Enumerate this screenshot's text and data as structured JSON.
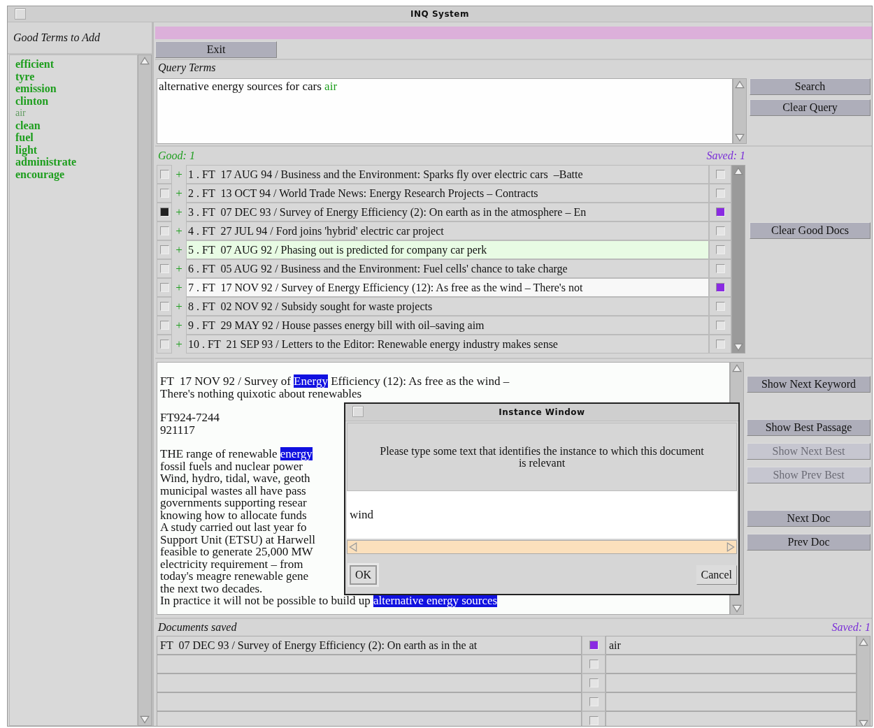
{
  "window": {
    "title": "INQ System"
  },
  "good_terms": {
    "heading": "Good Terms to Add",
    "terms": [
      {
        "text": "efficient",
        "added": false
      },
      {
        "text": "tyre",
        "added": false
      },
      {
        "text": "emission",
        "added": false
      },
      {
        "text": "clinton",
        "added": false
      },
      {
        "text": "air",
        "added": true
      },
      {
        "text": "clean",
        "added": false
      },
      {
        "text": "fuel",
        "added": false
      },
      {
        "text": "light",
        "added": false
      },
      {
        "text": "administrate",
        "added": false
      },
      {
        "text": "encourage",
        "added": false
      }
    ]
  },
  "exit_button": "Exit",
  "query": {
    "label": "Query Terms",
    "terms": [
      {
        "text": "alternative energy sources for cars",
        "kind": "typed"
      },
      {
        "text": "air",
        "kind": "added"
      }
    ],
    "buttons": [
      "Search",
      "Clear Query"
    ]
  },
  "results": {
    "good_count": "Good: 1",
    "saved_count": "Saved: 1",
    "rows": [
      {
        "marker": "+",
        "title": "1 . FT  17 AUG 94 / Business and the Environment: Sparks fly over electric cars  –Batte",
        "good": false,
        "saved": false,
        "highlighted": false,
        "selected": false
      },
      {
        "marker": "+",
        "title": "2 . FT  13 OCT 94 / World Trade News: Energy Research Projects – Contracts",
        "good": false,
        "saved": false,
        "highlighted": false,
        "selected": false
      },
      {
        "marker": "+",
        "title": "3 . FT  07 DEC 93 / Survey of Energy Efficiency (2): On earth as in the atmosphere – En",
        "good": true,
        "saved": true,
        "highlighted": false,
        "selected": false
      },
      {
        "marker": "+",
        "title": "4 . FT  27 JUL 94 / Ford joins 'hybrid' electric car project",
        "good": false,
        "saved": false,
        "highlighted": false,
        "selected": false
      },
      {
        "marker": "+",
        "title": "5 . FT  07 AUG 92 / Phasing out is predicted for company car perk",
        "good": false,
        "saved": false,
        "highlighted": true,
        "selected": false
      },
      {
        "marker": "+",
        "title": "6 . FT  05 AUG 92 / Business and the Environment: Fuel cells' chance to take charge",
        "good": false,
        "saved": false,
        "highlighted": false,
        "selected": false
      },
      {
        "marker": "+",
        "title": "7 . FT  17 NOV 92 / Survey of Energy Efficiency (12): As free as the wind – There's not",
        "good": false,
        "saved": true,
        "highlighted": false,
        "selected": true
      },
      {
        "marker": "+",
        "title": "8 . FT  02 NOV 92 / Subsidy sought for waste projects",
        "good": false,
        "saved": false,
        "highlighted": false,
        "selected": false
      },
      {
        "marker": "+",
        "title": "9 . FT  29 MAY 92 / House passes energy bill with oil–saving aim",
        "good": false,
        "saved": false,
        "highlighted": false,
        "selected": false
      },
      {
        "marker": "+",
        "title": "10 . FT  21 SEP 93 / Letters to the Editor: Renewable energy industry makes sense",
        "good": false,
        "saved": false,
        "highlighted": false,
        "selected": false
      }
    ],
    "clear_button": "Clear Good Docs"
  },
  "document": {
    "paragraphs": [
      {
        "lines": [
          [
            {
              "text": "FT  17 NOV 92 / Survey of ",
              "highlight": false
            },
            {
              "text": "Energy",
              "highlight": true
            },
            {
              "text": " Efficiency (12): As free as the wind –",
              "highlight": false
            }
          ],
          [
            {
              "text": "There's nothing quixotic about renewables",
              "highlight": false
            }
          ]
        ]
      },
      {
        "lines": [
          [
            {
              "text": "FT924-7244",
              "highlight": false
            }
          ],
          [
            {
              "text": "921117",
              "highlight": false
            }
          ]
        ]
      },
      {
        "lines": [
          [
            {
              "text": "THE range of renewable ",
              "highlight": false
            },
            {
              "text": "energy",
              "highlight": true
            }
          ],
          [
            {
              "text": "fossil fuels and nuclear power",
              "highlight": false
            }
          ],
          [
            {
              "text": "Wind, hydro, tidal, wave, geoth",
              "highlight": false
            }
          ],
          [
            {
              "text": "municipal wastes all have pass",
              "highlight": false
            }
          ],
          [
            {
              "text": "governments supporting resear",
              "highlight": false
            }
          ],
          [
            {
              "text": "knowing how to allocate funds",
              "highlight": false
            }
          ],
          [
            {
              "text": "A study carried out last year fo",
              "highlight": false
            }
          ],
          [
            {
              "text": "Support Unit (ETSU) at Harwell",
              "highlight": false
            }
          ],
          [
            {
              "text": "feasible to generate 25,000 MW",
              "highlight": false
            }
          ],
          [
            {
              "text": "electricity requirement – from",
              "highlight": false
            }
          ],
          [
            {
              "text": "today's meagre renewable gene",
              "highlight": false
            }
          ],
          [
            {
              "text": "the next two decades.",
              "highlight": false
            }
          ],
          [
            {
              "text": "In practice it will not be possible to build up ",
              "highlight": false
            },
            {
              "text": "alternative",
              "highlight": true
            },
            {
              "text": " energy",
              "highlight": true
            },
            {
              "text": " sources",
              "highlight": true
            }
          ]
        ]
      }
    ],
    "button_groups": [
      [
        {
          "label": "Show Next Keyword",
          "disabled": false
        }
      ],
      [
        {
          "label": "Show Best Passage",
          "disabled": false
        },
        {
          "label": "Show Next Best",
          "disabled": true
        },
        {
          "label": "Show Prev Best",
          "disabled": true
        }
      ],
      [
        {
          "label": "Next Doc",
          "disabled": false
        },
        {
          "label": "Prev Doc",
          "disabled": false
        }
      ]
    ]
  },
  "dialog": {
    "title": "Instance Window",
    "message": "Please type some text that identifies the instance to which this document is relevant",
    "value": "wind",
    "buttons": [
      {
        "label": "OK",
        "default": true
      },
      {
        "label": "Cancel",
        "default": false
      }
    ]
  },
  "saved": {
    "heading": "Documents saved",
    "count": "Saved: 1",
    "rows": [
      {
        "title": "FT  07 DEC 93 / Survey of Energy Efficiency (2): On earth as in the at",
        "saved": true,
        "instance": "air"
      },
      {
        "saved": false
      },
      {
        "saved": false
      },
      {
        "saved": false
      },
      {
        "saved": false
      }
    ]
  }
}
